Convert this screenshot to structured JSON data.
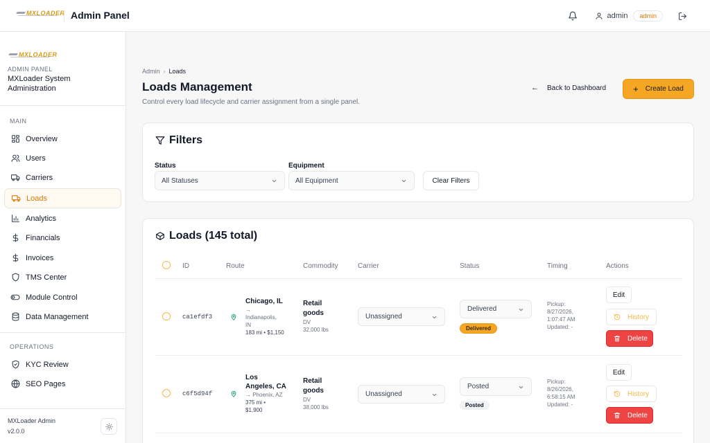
{
  "header": {
    "logo_text": "MXLOADER",
    "title": "Admin Panel",
    "user_name": "admin",
    "role_badge": "admin"
  },
  "sidebar": {
    "logo_text": "MXLOADER",
    "kicker": "ADMIN PANEL",
    "org": "MXLoader System Administration",
    "section_main": "MAIN",
    "section_operations": "OPERATIONS",
    "items": [
      {
        "label": "Overview",
        "icon": "grid-icon"
      },
      {
        "label": "Users",
        "icon": "users-icon"
      },
      {
        "label": "Carriers",
        "icon": "truck-icon"
      },
      {
        "label": "Loads",
        "icon": "truck-icon",
        "active": true
      },
      {
        "label": "Analytics",
        "icon": "bar-chart-icon"
      },
      {
        "label": "Financials",
        "icon": "dollar-icon"
      },
      {
        "label": "Invoices",
        "icon": "dollar-icon"
      },
      {
        "label": "TMS Center",
        "icon": "shield-icon"
      },
      {
        "label": "Module Control",
        "icon": "toggle-icon"
      },
      {
        "label": "Data Management",
        "icon": "database-icon"
      },
      {
        "label": "KYC Review",
        "icon": "shield-check-icon"
      },
      {
        "label": "SEO Pages",
        "icon": "globe-icon"
      }
    ],
    "footer_name": "MXLoader Admin",
    "footer_version": "v2.0.0"
  },
  "breadcrumb": {
    "root": "Admin",
    "current": "Loads"
  },
  "page": {
    "title": "Loads Management",
    "subtitle": "Control every load lifecycle and carrier assignment from a single panel.",
    "back_label": "Back to Dashboard",
    "create_label": "Create Load"
  },
  "filters": {
    "title": "Filters",
    "status_label": "Status",
    "status_value": "All Statuses",
    "equipment_label": "Equipment",
    "equipment_value": "All Equipment",
    "clear_label": "Clear Filters"
  },
  "loads": {
    "title": "Loads (145 total)",
    "columns": [
      "ID",
      "Route",
      "Commodity",
      "Carrier",
      "Status",
      "Timing",
      "Actions"
    ],
    "rows": [
      {
        "id": "ca1efdf3",
        "from": "Chicago, IL",
        "to_lines": [
          "→",
          "Indianapolis,",
          "IN"
        ],
        "meta_lines": [
          "183 mi • $1,150"
        ],
        "commodity_lines": [
          "Retail",
          "goods"
        ],
        "equipment": "DV",
        "weight": "32,000 lbs",
        "carrier": "Unassigned",
        "status_select": "Delivered",
        "status_pill": "Delivered",
        "pickup_lines": [
          "Pickup:",
          "8/27/2026,",
          "1:07:47 AM"
        ],
        "updated": "Updated: -"
      },
      {
        "id": "c6f5d94f",
        "from_lines": [
          "Los",
          "Angeles, CA"
        ],
        "to_lines": [
          "→ Phoenix, AZ"
        ],
        "meta_lines": [
          "375 mi •",
          "$1,900"
        ],
        "commodity_lines": [
          "Retail",
          "goods"
        ],
        "equipment": "DV",
        "weight": "38,000 lbs",
        "carrier": "Unassigned",
        "status_select": "Posted",
        "status_pill": "Posted",
        "pickup_lines": [
          "Pickup:",
          "8/26/2026,",
          "6:58:15 AM"
        ],
        "updated": "Updated: -"
      }
    ],
    "actions": {
      "edit": "Edit",
      "history": "History",
      "delete": "Delete"
    }
  },
  "colors": {
    "accent": "#f5a623",
    "danger": "#ef4444",
    "success": "#22a06b"
  }
}
